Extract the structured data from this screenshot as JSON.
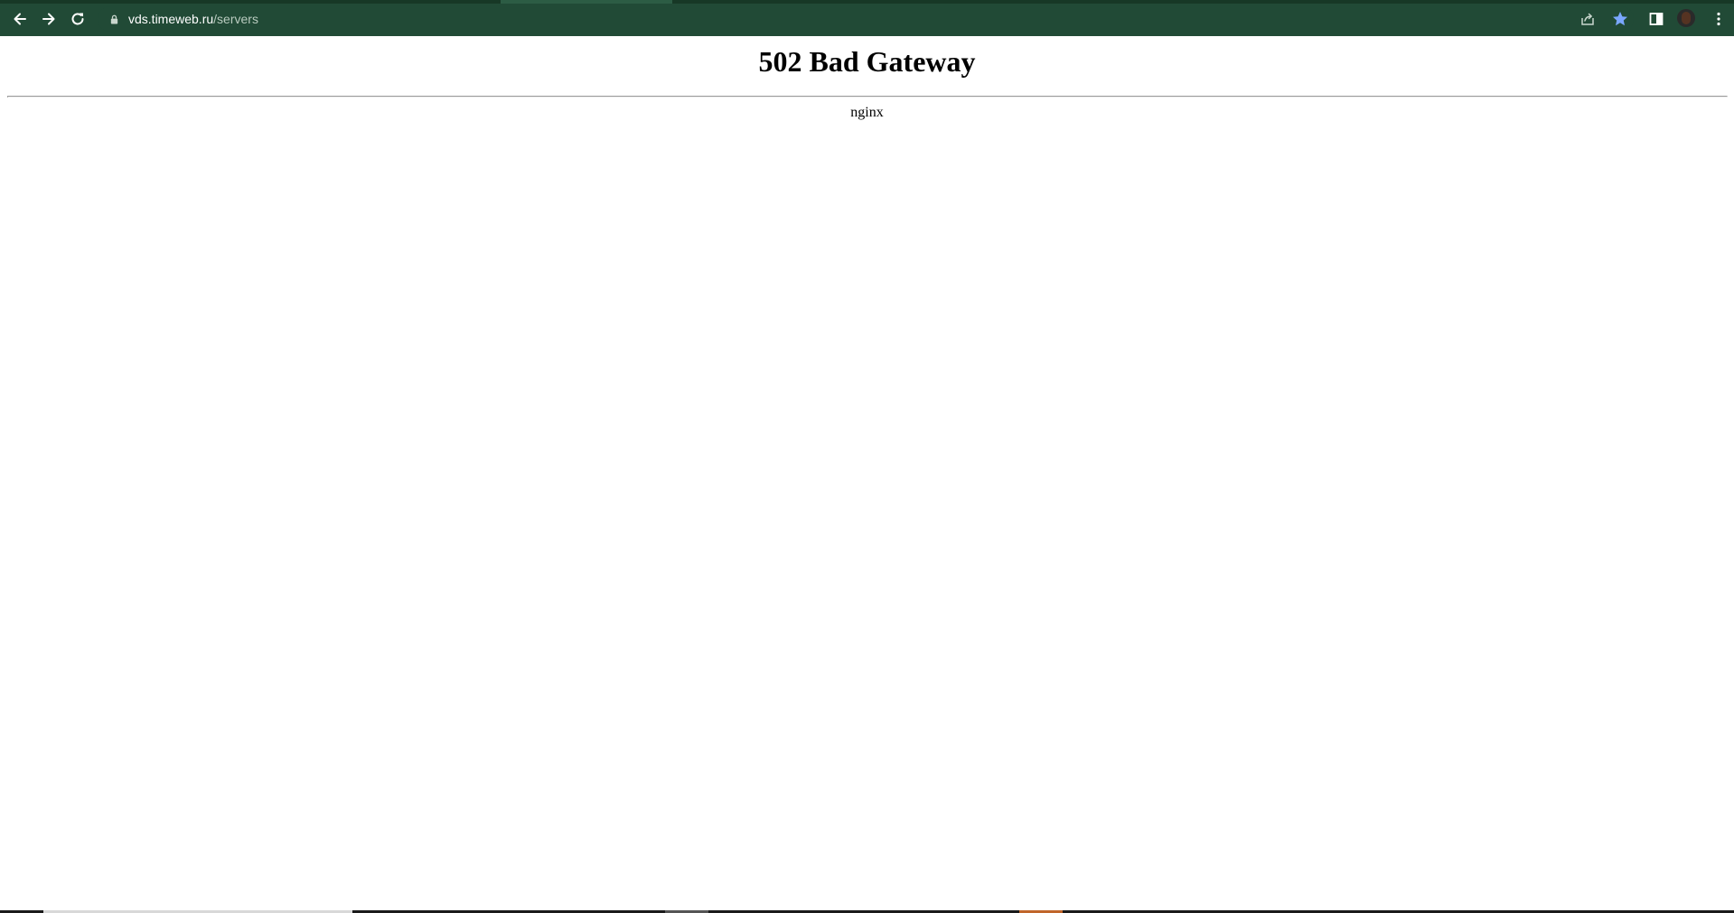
{
  "browser": {
    "url_host": "vds.timeweb.ru",
    "url_path": "/servers",
    "icons": {
      "back": "arrow-left-icon",
      "forward": "arrow-right-icon",
      "reload": "reload-icon",
      "lock": "lock-icon",
      "share": "share-icon",
      "bookmark": "star-icon",
      "side_panel": "side-panel-icon",
      "profile": "avatar",
      "menu": "kebab-menu-icon"
    },
    "colors": {
      "toolbar": "#214a36",
      "bookmark_star": "#7aa7ff"
    }
  },
  "page": {
    "title": "502 Bad Gateway",
    "server": "nginx"
  }
}
